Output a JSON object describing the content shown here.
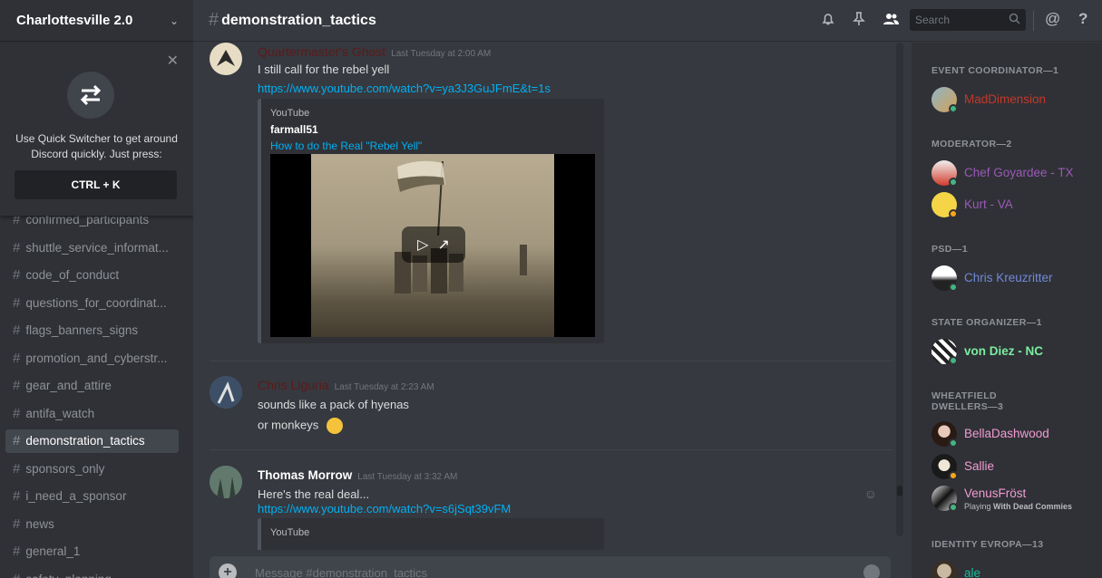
{
  "server": {
    "name": "Charlottesville 2.0"
  },
  "quick_switcher": {
    "text": "Use Quick Switcher to get around Discord quickly. Just press:",
    "shortcut": "CTRL + K"
  },
  "channels": [
    {
      "name": "confirmed_participants",
      "active": false
    },
    {
      "name": "shuttle_service_informat...",
      "active": false
    },
    {
      "name": "code_of_conduct",
      "active": false
    },
    {
      "name": "questions_for_coordinat...",
      "active": false
    },
    {
      "name": "flags_banners_signs",
      "active": false
    },
    {
      "name": "promotion_and_cyberstr...",
      "active": false
    },
    {
      "name": "gear_and_attire",
      "active": false
    },
    {
      "name": "antifa_watch",
      "active": false
    },
    {
      "name": "demonstration_tactics",
      "active": true
    },
    {
      "name": "sponsors_only",
      "active": false
    },
    {
      "name": "i_need_a_sponsor",
      "active": false
    },
    {
      "name": "news",
      "active": false
    },
    {
      "name": "general_1",
      "active": false
    },
    {
      "name": "safety_planning",
      "active": false
    }
  ],
  "header": {
    "channel": "demonstration_tactics",
    "search_placeholder": "Search",
    "icons": [
      "bell-icon",
      "pin-icon",
      "members-icon",
      "search-icon",
      "mention-icon",
      "help-icon"
    ]
  },
  "messages": [
    {
      "author": "Quartermaster's Ghost",
      "author_color": "#5c1a1a",
      "timestamp": "Last Tuesday at 2:00 AM",
      "lines": [
        "I still call for the rebel yell"
      ],
      "link": "https://www.youtube.com/watch?v=ya3J3GuJFmE&t=1s",
      "embed": {
        "provider": "YouTube",
        "author": "farmall51",
        "title": "How to do the Real \"Rebel Yell\""
      }
    },
    {
      "author": "Chris Liguria",
      "author_color": "#5c1a1a",
      "timestamp": "Last Tuesday at 2:23 AM",
      "lines": [
        "sounds like a pack of hyenas",
        "or monkeys"
      ]
    },
    {
      "author": "Thomas Morrow",
      "author_color": "#ffffff",
      "timestamp": "Last Tuesday at 3:32 AM",
      "lines": [
        "Here's the real deal..."
      ],
      "link": "https://www.youtube.com/watch?v=s6jSqt39vFM",
      "embed": {
        "provider": "YouTube"
      }
    }
  ],
  "composer": {
    "placeholder": "Message #demonstration_tactics"
  },
  "members": {
    "roles": [
      {
        "title": "EVENT COORDINATOR—1",
        "members": [
          {
            "name": "MadDimension",
            "color": "#c0392b",
            "status": "#43b581"
          }
        ]
      },
      {
        "title": "MODERATOR—2",
        "members": [
          {
            "name": "Chef Goyardee - TX",
            "color": "#9b59b6",
            "status": "#43b581"
          },
          {
            "name": "Kurt - VA",
            "color": "#9b59b6",
            "status": "#faa61a"
          }
        ]
      },
      {
        "title": "PSD—1",
        "members": [
          {
            "name": "Chris Kreuzritter",
            "color": "#7289da",
            "status": "#43b581"
          }
        ]
      },
      {
        "title": "STATE ORGANIZER—1",
        "members": [
          {
            "name": "von Diez - NC",
            "color": "#7bed9f",
            "status": "#43b581"
          }
        ]
      },
      {
        "title": "WHEATFIELD DWELLERS—3",
        "members": [
          {
            "name": "BellaDashwood",
            "color": "#f29bd4",
            "status": "#43b581"
          },
          {
            "name": "Sallie",
            "color": "#f29bd4",
            "status": "#faa61a"
          },
          {
            "name": "VenusFröst",
            "color": "#f29bd4",
            "status": "#43b581",
            "activity_prefix": "Playing",
            "activity": "With Dead Commies"
          }
        ]
      },
      {
        "title": "IDENTITY EVROPA—13",
        "members": [
          {
            "name": "ale",
            "color": "#1abc9c",
            "status": "#43b581"
          }
        ]
      }
    ]
  }
}
